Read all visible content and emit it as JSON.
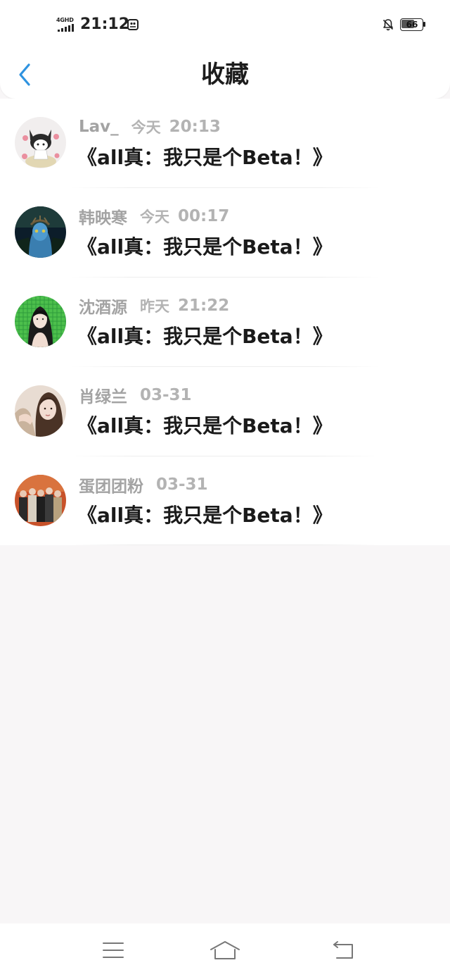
{
  "status_bar": {
    "network": "4GHD",
    "time": "21:12",
    "battery": "66"
  },
  "header": {
    "title": "收藏"
  },
  "favorites": [
    {
      "user": "Lav_",
      "day": "今天",
      "time": "20:13",
      "title": "《all真：我只是个Beta！》"
    },
    {
      "user": "韩映寒",
      "day": "今天",
      "time": "00:17",
      "title": "《all真：我只是个Beta！》"
    },
    {
      "user": "沈酒源",
      "day": "昨天",
      "time": "21:22",
      "title": "《all真：我只是个Beta！》"
    },
    {
      "user": "肖绿兰",
      "day": "",
      "time": "03-31",
      "title": "《all真：我只是个Beta！》"
    },
    {
      "user": "蛋团团粉",
      "day": "",
      "time": "03-31",
      "title": "《all真：我只是个Beta！》"
    }
  ],
  "colors": {
    "accent": "#2f93e0",
    "title_text": "#1a1a1a",
    "meta_text": "#a5a5a5",
    "background": "#f8f6f7"
  },
  "icons": {
    "back": "chevron-left-icon",
    "menu": "menu-icon",
    "home": "home-icon",
    "return": "back-arrow-icon"
  }
}
